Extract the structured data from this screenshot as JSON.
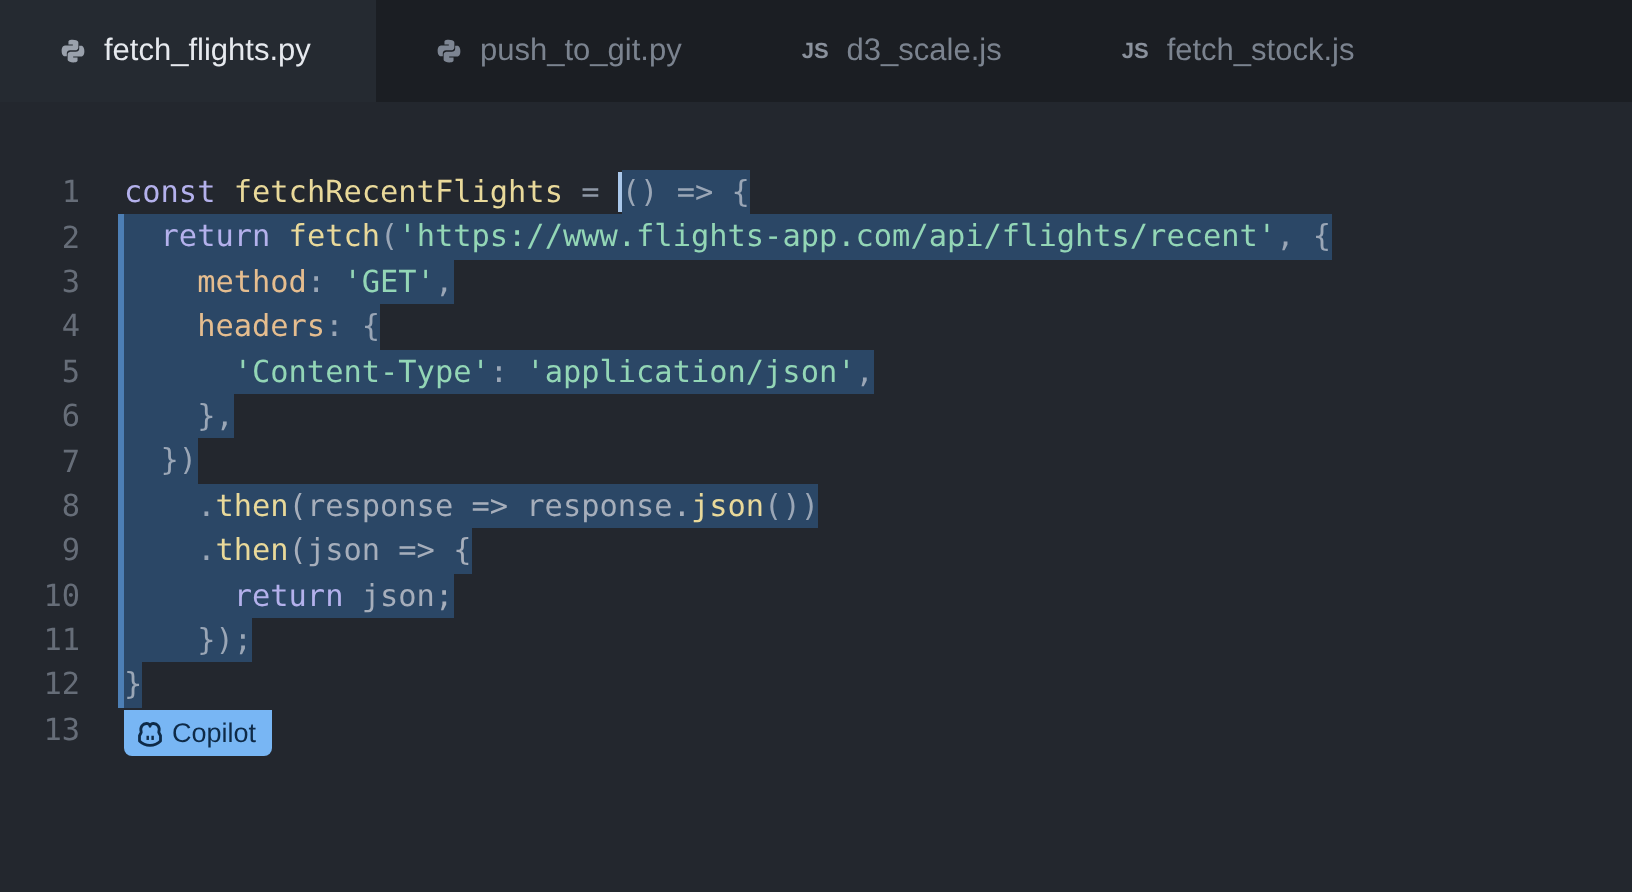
{
  "tabs": [
    {
      "kind": "python",
      "label": "fetch_flights.py",
      "selected": true
    },
    {
      "kind": "python",
      "label": "push_to_git.py",
      "selected": false
    },
    {
      "kind": "js",
      "badge": "JS",
      "label": "d3_scale.js",
      "selected": false
    },
    {
      "kind": "js",
      "badge": "JS",
      "label": "fetch_stock.js",
      "selected": false
    }
  ],
  "editor": {
    "lines": [
      {
        "number": "1",
        "plain": [
          {
            "kind": "kw",
            "text": "const "
          },
          {
            "kind": "fn",
            "text": "fetchRecentFlights"
          },
          {
            "kind": "punct",
            "text": " = "
          }
        ],
        "selected": [
          {
            "kind": "punct",
            "text": "() => {"
          }
        ]
      },
      {
        "number": "2",
        "selected": [
          {
            "kind": "kw",
            "text": "  return "
          },
          {
            "kind": "fn",
            "text": "fetch"
          },
          {
            "kind": "punct",
            "text": "("
          },
          {
            "kind": "str",
            "text": "'https://www.flights-app.com/api/flights/recent'"
          },
          {
            "kind": "punct",
            "text": ", {"
          }
        ]
      },
      {
        "number": "3",
        "selected": [
          {
            "kind": "prop",
            "text": "    method"
          },
          {
            "kind": "punct",
            "text": ": "
          },
          {
            "kind": "str",
            "text": "'GET'"
          },
          {
            "kind": "punct",
            "text": ","
          }
        ]
      },
      {
        "number": "4",
        "selected": [
          {
            "kind": "prop",
            "text": "    headers"
          },
          {
            "kind": "punct",
            "text": ": {"
          }
        ]
      },
      {
        "number": "5",
        "selected": [
          {
            "kind": "str",
            "text": "      'Content-Type'"
          },
          {
            "kind": "punct",
            "text": ": "
          },
          {
            "kind": "str",
            "text": "'application/json'"
          },
          {
            "kind": "punct",
            "text": ","
          }
        ]
      },
      {
        "number": "6",
        "selected": [
          {
            "kind": "punct",
            "text": "    },"
          }
        ]
      },
      {
        "number": "7",
        "selected": [
          {
            "kind": "punct",
            "text": "  })"
          }
        ]
      },
      {
        "number": "8",
        "selected": [
          {
            "kind": "punct",
            "text": "    ."
          },
          {
            "kind": "fn",
            "text": "then"
          },
          {
            "kind": "var",
            "text": "(response => response."
          },
          {
            "kind": "fn",
            "text": "json"
          },
          {
            "kind": "punct",
            "text": "())"
          }
        ]
      },
      {
        "number": "9",
        "selected": [
          {
            "kind": "punct",
            "text": "    ."
          },
          {
            "kind": "fn",
            "text": "then"
          },
          {
            "kind": "var",
            "text": "(json => {"
          }
        ]
      },
      {
        "number": "10",
        "selected": [
          {
            "kind": "kw",
            "text": "      return"
          },
          {
            "kind": "var",
            "text": " json;"
          }
        ]
      },
      {
        "number": "11",
        "selected": [
          {
            "kind": "punct",
            "text": "    });"
          }
        ]
      },
      {
        "number": "12",
        "selected": [
          {
            "kind": "punct",
            "text": "}"
          }
        ]
      },
      {
        "number": "13",
        "badge": "Copilot"
      }
    ]
  }
}
